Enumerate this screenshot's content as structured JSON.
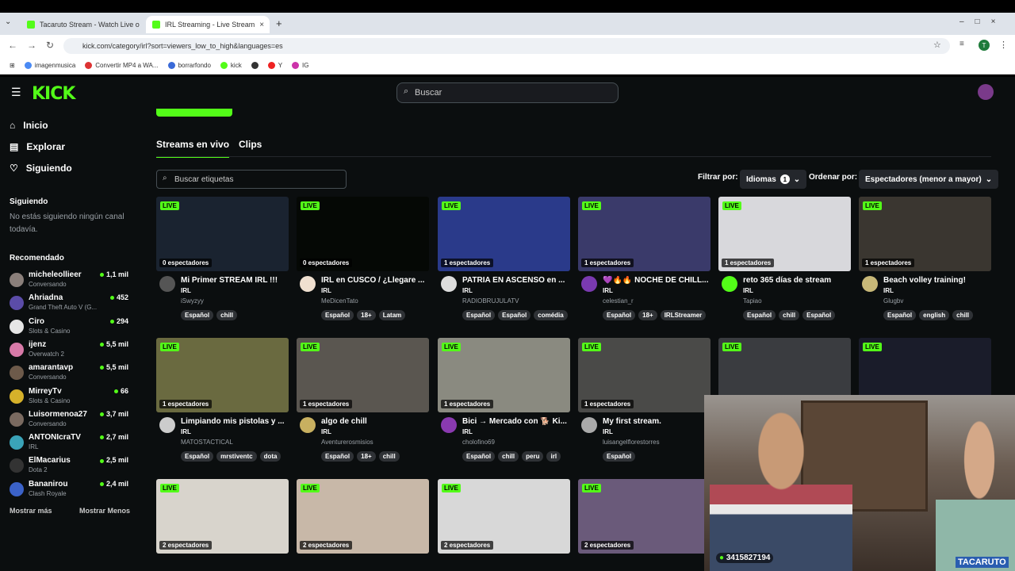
{
  "browser": {
    "tabs": [
      {
        "title": "Tacaruto Stream - Watch Live o"
      },
      {
        "title": "IRL Streaming - Live Stream"
      }
    ],
    "new_tab": "+",
    "url": "kick.com/category/irl?sort=viewers_low_to_high&languages=es",
    "bookmarks": [
      "imagenmusica",
      "Convertir MP4 a WA...",
      "borrarfondo",
      "kick",
      "Y",
      "IG"
    ],
    "profile_initial": "T"
  },
  "header": {
    "logo": "KICK",
    "search_placeholder": "Buscar"
  },
  "sidebar": {
    "nav": [
      {
        "label": "Inicio",
        "icon": "home-icon"
      },
      {
        "label": "Explorar",
        "icon": "browse-icon"
      },
      {
        "label": "Siguiendo",
        "icon": "heart-icon"
      }
    ],
    "following_title": "Siguiendo",
    "following_empty": "No estás siguiendo ningún canal todavía.",
    "recommended_title": "Recomendado",
    "recommended": [
      {
        "name": "micheleollieer",
        "category": "Conversando",
        "viewers": "1,1 mil",
        "color": "#8a7f7a"
      },
      {
        "name": "Ahriadna",
        "category": "Grand Theft Auto V (G...",
        "viewers": "452",
        "color": "#5b4ca8"
      },
      {
        "name": "Ciro",
        "category": "Slots & Casino",
        "viewers": "294",
        "color": "#e6e6e6"
      },
      {
        "name": "ijenz",
        "category": "Overwatch 2",
        "viewers": "5,5 mil",
        "color": "#d87aa8"
      },
      {
        "name": "amarantavp",
        "category": "Conversando",
        "viewers": "5,5 mil",
        "color": "#6d5a4a"
      },
      {
        "name": "MirreyTv",
        "category": "Slots & Casino",
        "viewers": "66",
        "color": "#d6b12a"
      },
      {
        "name": "Luisormenoa27",
        "category": "Conversando",
        "viewers": "3,7 mil",
        "color": "#7a6a60"
      },
      {
        "name": "ANTONIcraTV",
        "category": "IRL",
        "viewers": "2,7 mil",
        "color": "#3aa3b8"
      },
      {
        "name": "ElMacarius",
        "category": "Dota 2",
        "viewers": "2,5 mil",
        "color": "#333333"
      },
      {
        "name": "Bananirou",
        "category": "Clash Royale",
        "viewers": "2,4 mil",
        "color": "#3b62c8"
      }
    ],
    "show_more": "Mostrar más",
    "show_less": "Mostrar Menos"
  },
  "content": {
    "tabs": [
      "Streams en vivo",
      "Clips"
    ],
    "tag_search_placeholder": "Buscar etiquetas",
    "filter_label": "Filtrar por:",
    "filter_value": "Idiomas",
    "filter_count": "1",
    "sort_label": "Ordenar por:",
    "sort_value": "Espectadores (menor a mayor)",
    "live_badge": "LIVE",
    "cards": [
      {
        "viewers": "0 espectadores",
        "title": "Mi Primer STREAM IRL !!!",
        "category": "IRL",
        "user": "iSwyzyy",
        "tags": [
          "Español",
          "chill"
        ],
        "thumb": "#1a2330",
        "avatar": "#555"
      },
      {
        "viewers": "0 espectadores",
        "title": "IRL en CUSCO / ¿Llegare ...",
        "category": "IRL",
        "user": "MeDicenTato",
        "tags": [
          "Español",
          "18+",
          "Latam"
        ],
        "thumb": "#050805",
        "avatar": "#f0e0d0"
      },
      {
        "viewers": "1 espectadores",
        "title": "PATRIA EN ASCENSO en ...",
        "category": "IRL",
        "user": "RADIOBRUJULATV",
        "tags": [
          "Español",
          "Español",
          "comédia"
        ],
        "thumb": "#2a3a8a",
        "avatar": "#ddd"
      },
      {
        "viewers": "1 espectadores",
        "title": "💜🔥🔥 NOCHE DE CHILL...",
        "category": "IRL",
        "user": "celestian_r",
        "tags": [
          "Español",
          "18+",
          "IRLStreamer"
        ],
        "thumb": "#3a3a6a",
        "avatar": "#7a3ab0"
      },
      {
        "viewers": "1 espectadores",
        "title": "reto 365 días de stream",
        "category": "IRL",
        "user": "Tapiao",
        "tags": [
          "Español",
          "chill",
          "Español"
        ],
        "thumb": "#d8d8dc",
        "avatar": "#53fc18"
      },
      {
        "viewers": "1 espectadores",
        "title": "Beach volley training!",
        "category": "IRL",
        "user": "Glugbv",
        "tags": [
          "Español",
          "english",
          "chill"
        ],
        "thumb": "#3a3630",
        "avatar": "#c8b878"
      },
      {
        "viewers": "1 espectadores",
        "title": "Limpiando mis pistolas y ...",
        "category": "IRL",
        "user": "MATOSTACTICAL",
        "tags": [
          "Español",
          "mrstiventc",
          "dota"
        ],
        "thumb": "#6a6a40",
        "avatar": "#ccc"
      },
      {
        "viewers": "1 espectadores",
        "title": "algo de chill",
        "category": "IRL",
        "user": "Aventurerosmisios",
        "tags": [
          "Español",
          "18+",
          "chill"
        ],
        "thumb": "#5a5650",
        "avatar": "#c8b060"
      },
      {
        "viewers": "1 espectadores",
        "title": "Bici → Mercado con 🐕 Ki...",
        "category": "IRL",
        "user": "cholofino69",
        "tags": [
          "Español",
          "chill",
          "peru",
          "irl"
        ],
        "thumb": "#8a8a80",
        "avatar": "#8a3ab0"
      },
      {
        "viewers": "1 espectadores",
        "title": "My first stream.",
        "category": "IRL",
        "user": "luisangelflorestorres",
        "tags": [
          "Español"
        ],
        "thumb": "#4a4a48",
        "avatar": "#aaa"
      },
      {
        "viewers": "",
        "title": "",
        "category": "",
        "user": "",
        "tags": [],
        "thumb": "#3a3c40",
        "avatar": ""
      },
      {
        "viewers": "",
        "title": "",
        "category": "",
        "user": "",
        "tags": [],
        "thumb": "#1a1c2a",
        "avatar": ""
      },
      {
        "viewers": "2 espectadores",
        "title": "",
        "category": "",
        "user": "",
        "tags": [],
        "thumb": "#d8d4cc",
        "avatar": ""
      },
      {
        "viewers": "2 espectadores",
        "title": "",
        "category": "",
        "user": "",
        "tags": [],
        "thumb": "#c8b8a8",
        "avatar": ""
      },
      {
        "viewers": "2 espectadores",
        "title": "",
        "category": "",
        "user": "",
        "tags": [],
        "thumb": "#d8d8d8",
        "avatar": ""
      },
      {
        "viewers": "2 espectadores",
        "title": "",
        "category": "",
        "user": "",
        "tags": [],
        "thumb": "#6a5a7a",
        "avatar": ""
      }
    ]
  },
  "overlay": {
    "phone": "3415827194",
    "brand": "TACARUTO"
  }
}
